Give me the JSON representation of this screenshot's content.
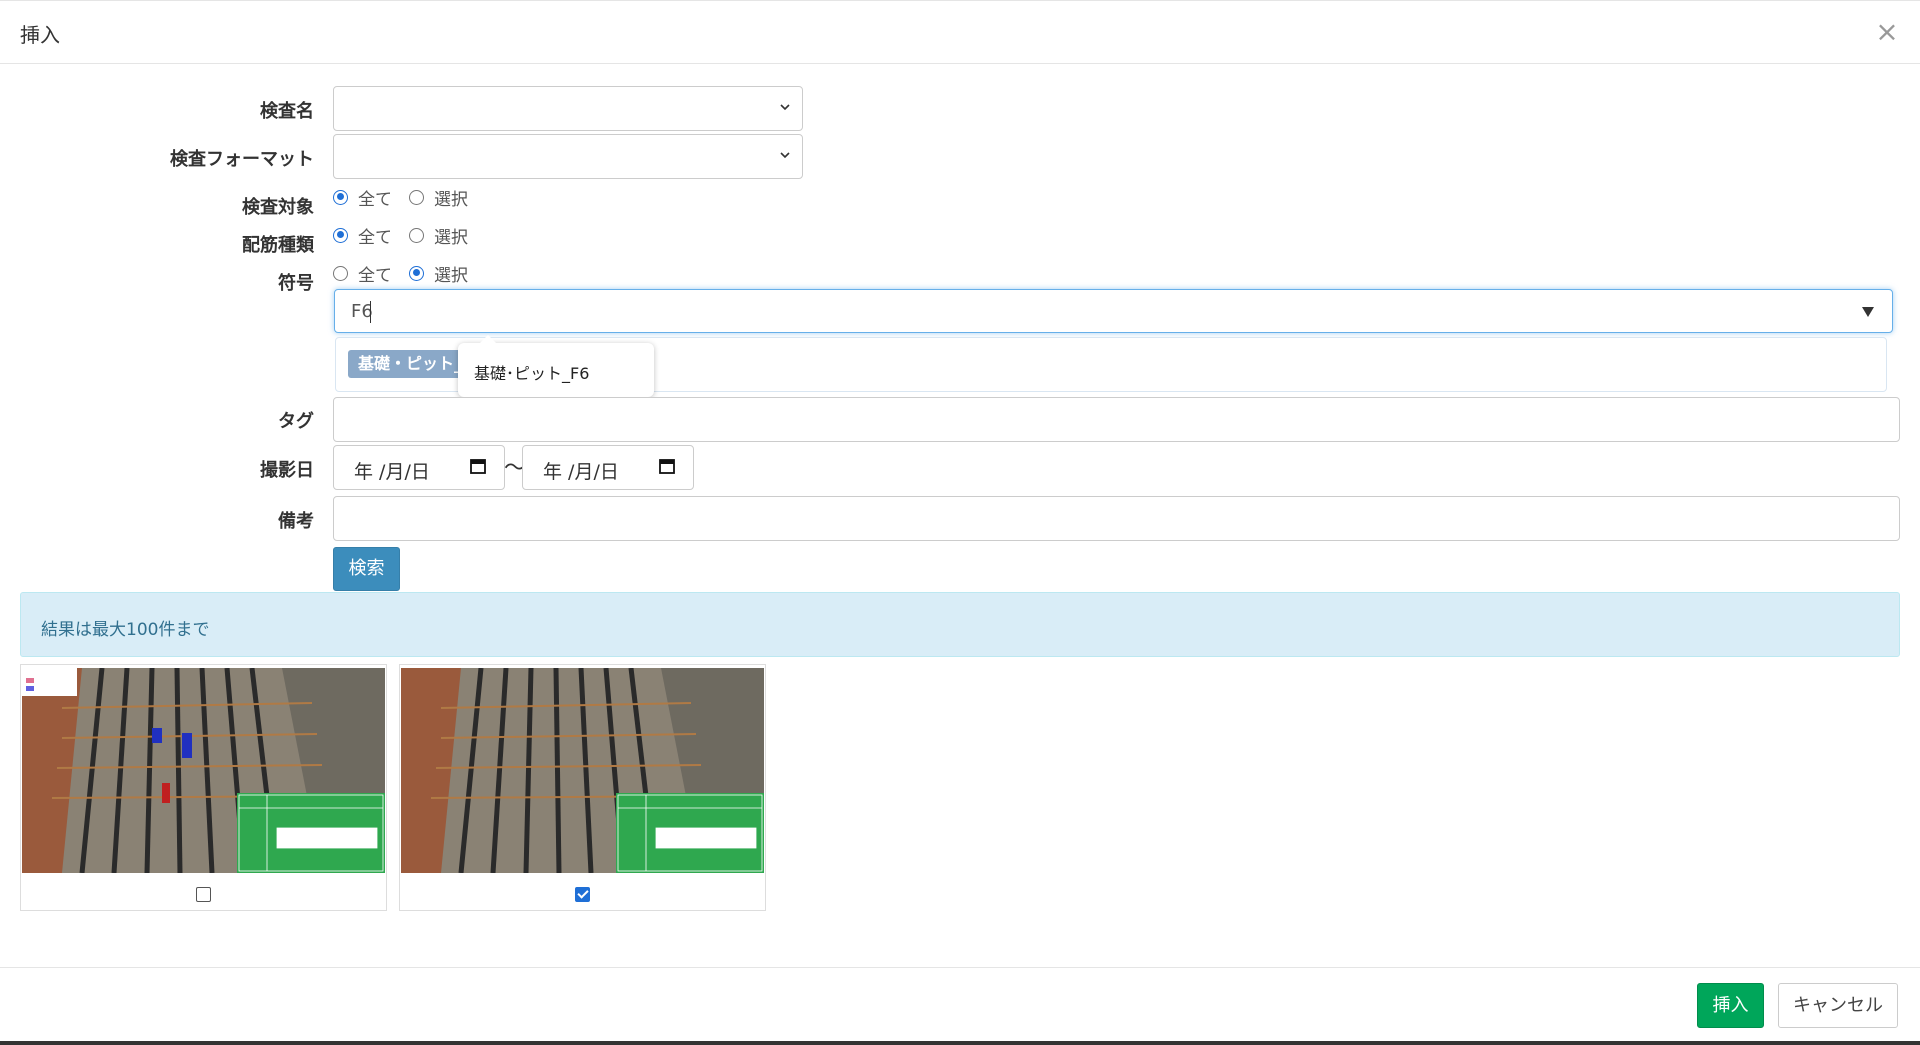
{
  "modal": {
    "title": "挿入"
  },
  "form": {
    "inspection_name_label": "検査名",
    "inspection_format_label": "検査フォーマット",
    "inspection_target_label": "検査対象",
    "rebar_type_label": "配筋種類",
    "symbol_label": "符号",
    "tag_label": "タグ",
    "shoot_date_label": "撮影日",
    "remarks_label": "備考",
    "radio_all": "全て",
    "radio_select": "選択",
    "inspection_target_selected": "全て",
    "rebar_type_selected": "全て",
    "symbol_selected": "選択",
    "symbol_input_value": "F6",
    "symbol_chip": "基礎・ピット_F6",
    "symbol_suggestion": "基礎･ピット_F6",
    "date_from": "年 /月/日",
    "date_to": "年 /月/日",
    "date_separator": "〜",
    "search_button": "検索"
  },
  "results": {
    "info_text": "結果は最大100件まで",
    "items": [
      {
        "checked": false
      },
      {
        "checked": true
      }
    ]
  },
  "footer": {
    "insert_button": "挿入",
    "cancel_button": "キャンセル"
  },
  "colors": {
    "primary": "#3c8dbc",
    "success": "#00a65a",
    "info_bg": "#d9edf7",
    "info_text": "#31708f",
    "chip": "#8aa8c8",
    "focus": "#66afe9"
  }
}
